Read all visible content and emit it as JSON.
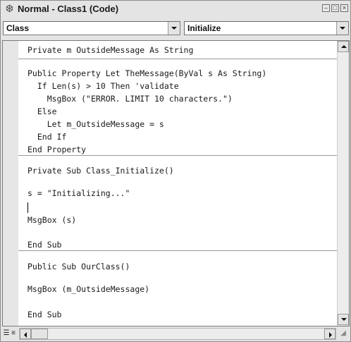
{
  "window": {
    "title": "Normal - Class1 (Code)",
    "icon": "module-icon"
  },
  "object_combo": {
    "selected": "Class"
  },
  "procedure_combo": {
    "selected": "Initialize"
  },
  "code_lines": [
    "Private m OutsideMessage As String",
    "Public Property Let TheMessage(ByVal s As String)",
    "  If Len(s) > 10 Then 'validate",
    "    MsgBox (\"ERROR. LIMIT 10 characters.\")",
    "  Else",
    "    Let m_OutsideMessage = s",
    "  End If",
    "End Property",
    "Private Sub Class_Initialize()",
    "s = \"Initializing...\"",
    "MsgBox (s)",
    "End Sub",
    "Public Sub OurClass()",
    "MsgBox (m_OutsideMessage)",
    "End Sub"
  ],
  "colors": {
    "comment": "#1a1a1a",
    "text": "#1a1a1a",
    "chrome": "#e4e4e4"
  }
}
